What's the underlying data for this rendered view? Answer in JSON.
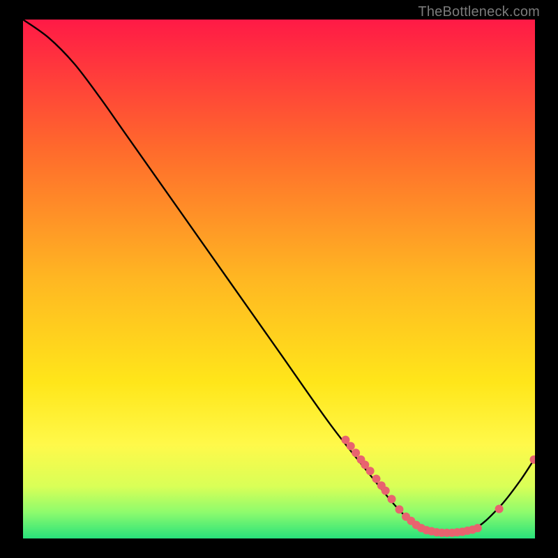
{
  "watermark": "TheBottleneck.com",
  "chart_data": {
    "type": "line",
    "title": "",
    "xlabel": "",
    "ylabel": "",
    "xlim": [
      0,
      100
    ],
    "ylim": [
      0,
      100
    ],
    "grid": false,
    "legend": false,
    "background_gradient": {
      "stops": [
        {
          "pos": 0.0,
          "color": "#ff1a46"
        },
        {
          "pos": 0.25,
          "color": "#ff6a2c"
        },
        {
          "pos": 0.5,
          "color": "#ffb722"
        },
        {
          "pos": 0.7,
          "color": "#ffe61a"
        },
        {
          "pos": 0.82,
          "color": "#fff94a"
        },
        {
          "pos": 0.9,
          "color": "#d9ff57"
        },
        {
          "pos": 0.95,
          "color": "#8dfb6d"
        },
        {
          "pos": 1.0,
          "color": "#28e27b"
        }
      ]
    },
    "curve": {
      "comment": "x is fraction of width (0..1), y is fraction of height from top (0..1). Curve estimated from pixels.",
      "points": [
        {
          "x": 0.0,
          "y": 0.0
        },
        {
          "x": 0.05,
          "y": 0.035
        },
        {
          "x": 0.1,
          "y": 0.085
        },
        {
          "x": 0.15,
          "y": 0.15
        },
        {
          "x": 0.2,
          "y": 0.22
        },
        {
          "x": 0.3,
          "y": 0.36
        },
        {
          "x": 0.4,
          "y": 0.5
        },
        {
          "x": 0.5,
          "y": 0.64
        },
        {
          "x": 0.6,
          "y": 0.78
        },
        {
          "x": 0.68,
          "y": 0.88
        },
        {
          "x": 0.73,
          "y": 0.94
        },
        {
          "x": 0.77,
          "y": 0.975
        },
        {
          "x": 0.82,
          "y": 0.99
        },
        {
          "x": 0.88,
          "y": 0.982
        },
        {
          "x": 0.93,
          "y": 0.94
        },
        {
          "x": 0.97,
          "y": 0.89
        },
        {
          "x": 1.0,
          "y": 0.845
        }
      ]
    },
    "scatter": {
      "color": "#e8636f",
      "radius": 6,
      "comment": "x,y in same normalized space as curve; clustered markers along lower portion of curve.",
      "points": [
        {
          "x": 0.63,
          "y": 0.81
        },
        {
          "x": 0.64,
          "y": 0.822
        },
        {
          "x": 0.65,
          "y": 0.835
        },
        {
          "x": 0.66,
          "y": 0.848
        },
        {
          "x": 0.668,
          "y": 0.858
        },
        {
          "x": 0.678,
          "y": 0.87
        },
        {
          "x": 0.69,
          "y": 0.885
        },
        {
          "x": 0.7,
          "y": 0.898
        },
        {
          "x": 0.708,
          "y": 0.908
        },
        {
          "x": 0.72,
          "y": 0.924
        },
        {
          "x": 0.735,
          "y": 0.944
        },
        {
          "x": 0.748,
          "y": 0.958
        },
        {
          "x": 0.758,
          "y": 0.966
        },
        {
          "x": 0.768,
          "y": 0.974
        },
        {
          "x": 0.778,
          "y": 0.98
        },
        {
          "x": 0.788,
          "y": 0.984
        },
        {
          "x": 0.798,
          "y": 0.986
        },
        {
          "x": 0.808,
          "y": 0.988
        },
        {
          "x": 0.818,
          "y": 0.989
        },
        {
          "x": 0.828,
          "y": 0.989
        },
        {
          "x": 0.838,
          "y": 0.989
        },
        {
          "x": 0.848,
          "y": 0.988
        },
        {
          "x": 0.858,
          "y": 0.987
        },
        {
          "x": 0.868,
          "y": 0.985
        },
        {
          "x": 0.878,
          "y": 0.983
        },
        {
          "x": 0.888,
          "y": 0.98
        },
        {
          "x": 0.93,
          "y": 0.943
        },
        {
          "x": 0.998,
          "y": 0.848
        }
      ]
    }
  }
}
